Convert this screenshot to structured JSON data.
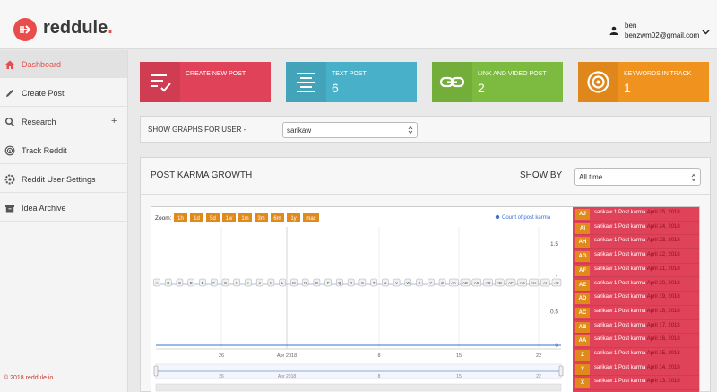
{
  "app": {
    "logo_text": "reddule",
    "logo_dot": ".",
    "brand_color": "#e94c4c"
  },
  "user": {
    "name": "ben",
    "email": "benzwm02@gmail.com",
    "icon": "person-icon"
  },
  "sidebar": {
    "items": [
      {
        "label": "Dashboard",
        "icon": "home-icon",
        "active": true
      },
      {
        "label": "Create Post",
        "icon": "pencil-icon"
      },
      {
        "label": "Research",
        "icon": "search-icon",
        "expandable": "+"
      },
      {
        "label": "Track Reddit",
        "icon": "radar-icon"
      },
      {
        "label": "Reddit User Settings",
        "icon": "gear-icon"
      },
      {
        "label": "Idea Archive",
        "icon": "archive-icon"
      }
    ],
    "footer": "© 2018 reddule.io ."
  },
  "cards": [
    {
      "title": "CREATE NEW POST",
      "value": "",
      "icon": "checklist-icon",
      "color": "#e04259"
    },
    {
      "title": "TEXT POST",
      "value": "6",
      "icon": "align-center-icon",
      "color": "#48b0c8"
    },
    {
      "title": "LINK AND VIDEO POST",
      "value": "2",
      "icon": "link-icon",
      "color": "#7cbb3f"
    },
    {
      "title": "KEYWORDS IN TRACK",
      "value": "1",
      "icon": "target-icon",
      "color": "#f0921e"
    }
  ],
  "filter": {
    "label": "SHOW GRAPHS FOR USER -",
    "selected_user": "sarikaw"
  },
  "panel": {
    "title": "POST KARMA GROWTH",
    "show_by_label": "SHOW BY",
    "range_selected": "All time"
  },
  "chart_data": {
    "type": "line",
    "zoom_label": "Zoom:",
    "zoom_buttons": [
      "1h",
      "1d",
      "5d",
      "1w",
      "1m",
      "3m",
      "6m",
      "1y",
      "max"
    ],
    "legend": "Count of post karma",
    "y_ticks": [
      "0",
      "0.5",
      "1",
      "1.5"
    ],
    "ylim": [
      0,
      1.7
    ],
    "x_ticks": [
      "26",
      "Apr 2018",
      "8",
      "15",
      "22"
    ],
    "nav_ticks": [
      "26",
      "Apr 2018",
      "8",
      "15",
      "22"
    ],
    "flags": [
      "A",
      "B",
      "C",
      "D",
      "E",
      "F",
      "G",
      "H",
      "I",
      "J",
      "K",
      "L",
      "M",
      "N",
      "O",
      "P",
      "Q",
      "R",
      "S",
      "T",
      "U",
      "V",
      "W",
      "X",
      "Y",
      "Z",
      "AA",
      "AB",
      "AC",
      "AD",
      "AE",
      "AF",
      "AG",
      "AH",
      "AI",
      "AJ"
    ],
    "series": [
      {
        "name": "Count of post karma",
        "values": [
          0
        ]
      }
    ]
  },
  "post_list": [
    {
      "badge": "AJ",
      "text": "sarikaw 1 Post karma",
      "date": "April 25, 2018"
    },
    {
      "badge": "AI",
      "text": "sarikaw 1 Post karma",
      "date": "April 24, 2018"
    },
    {
      "badge": "AH",
      "text": "sarikaw 1 Post karma",
      "date": "April 23, 2018"
    },
    {
      "badge": "AG",
      "text": "sarikaw 1 Post karma",
      "date": "April 22, 2018"
    },
    {
      "badge": "AF",
      "text": "sarikaw 1 Post karma",
      "date": "April 21, 2018"
    },
    {
      "badge": "AE",
      "text": "sarikaw 1 Post karma",
      "date": "April 20, 2018"
    },
    {
      "badge": "AD",
      "text": "sarikaw 1 Post karma",
      "date": "April 19, 2018"
    },
    {
      "badge": "AC",
      "text": "sarikaw 1 Post karma",
      "date": "April 18, 2018"
    },
    {
      "badge": "AB",
      "text": "sarikaw 1 Post karma",
      "date": "April 17, 2018"
    },
    {
      "badge": "AA",
      "text": "sarikaw 1 Post karma",
      "date": "April 16, 2018"
    },
    {
      "badge": "Z",
      "text": "sarikaw 1 Post karma",
      "date": "April 15, 2018"
    },
    {
      "badge": "Y",
      "text": "sarikaw 1 Post karma",
      "date": "April 14, 2018"
    },
    {
      "badge": "X",
      "text": "sarikaw 1 Post karma",
      "date": "April 13, 2018"
    }
  ]
}
